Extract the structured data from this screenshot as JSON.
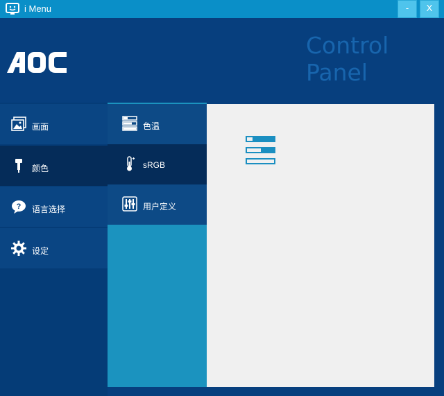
{
  "window": {
    "title": "i Menu",
    "minimize_label": "-",
    "close_label": "X"
  },
  "header": {
    "logo_text": "AOC",
    "panel_title": "Control Panel"
  },
  "menu": [
    {
      "label": "画面",
      "icon": "picture-icon",
      "active": false
    },
    {
      "label": "颜色",
      "icon": "color-probe-icon",
      "active": true
    },
    {
      "label": "语言选择",
      "icon": "language-question-icon",
      "active": false
    },
    {
      "label": "设定",
      "icon": "gear-icon",
      "active": false
    }
  ],
  "submenu": [
    {
      "label": "色温",
      "icon": "color-temp-icon",
      "active": false
    },
    {
      "label": "sRGB",
      "icon": "thermometer-icon",
      "active": true
    },
    {
      "label": "用户定义",
      "icon": "sliders-icon",
      "active": false
    }
  ],
  "content": {
    "icon": "level-bars-icon"
  },
  "colors": {
    "titlebar": "#0a8fc8",
    "background": "#073f7e",
    "active_item": "#052c59",
    "accent": "#1b93bf",
    "content_bg": "#f0f0f0",
    "panel_title": "#1865ad"
  }
}
